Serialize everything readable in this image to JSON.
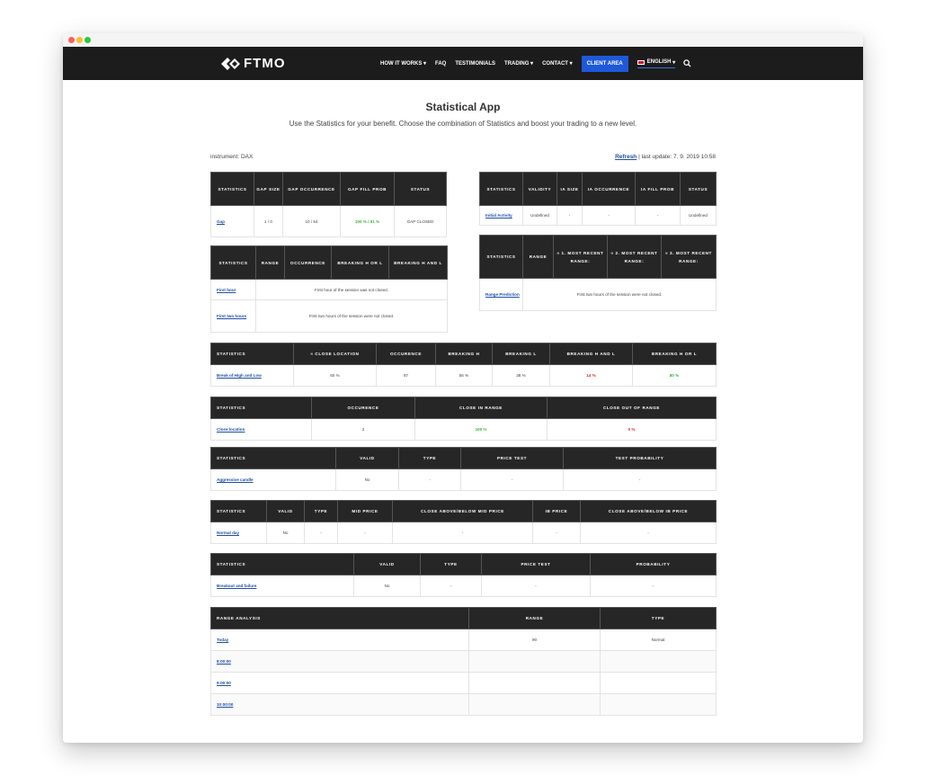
{
  "nav": {
    "logo": "FTMO",
    "items": [
      "HOW IT WORKS",
      "FAQ",
      "TESTIMONIALS",
      "TRADING",
      "CONTACT"
    ],
    "client_area": "CLIENT AREA",
    "language": "ENGLISH",
    "colors": {
      "bar": "#1c1c1c",
      "client_button": "#1e59d9"
    }
  },
  "page": {
    "title": "Statistical App",
    "subtitle": "Use the Statistics for your benefit. Choose the combination of Statistics and boost your trading to a new level.",
    "instrument": "instrument: DAX",
    "refresh": "Refresh",
    "last_update": " | last update: 7. 9. 2019 10:58"
  },
  "gap": {
    "headers": [
      "STATISTICS",
      "GAP SIZE",
      "GAP OCCURRENCE",
      "GAP FILL PROB",
      "STATUS"
    ],
    "row": {
      "stat": "Gap",
      "size": "1 / 0",
      "occurrence": "10 / 54",
      "fill_prob": "100 % / 91 %",
      "status": "GAP CLOSED"
    }
  },
  "ia": {
    "headers": [
      "STATISTICS",
      "VALIDITY",
      "IA SIZE",
      "IA OCCURRENCE",
      "IA FILL PROB",
      "STATUS"
    ],
    "row": {
      "stat": "Initial Activity",
      "validity": "Undefined",
      "size": "-",
      "occurrence": "-",
      "fill": "-",
      "status": "Undefined"
    }
  },
  "breaking": {
    "headers": [
      "STATISTICS",
      "RANGE",
      "OCCURRENCE",
      "BREAKING H OR L",
      "BREAKING H AND L"
    ],
    "rows": [
      {
        "stat": "First hour",
        "message": "First hour of the session was not closed."
      },
      {
        "stat": "First two hours",
        "message": "First two hours of the session were not closed."
      }
    ]
  },
  "range_pred": {
    "headers": [
      "STATISTICS",
      "RANGE",
      "≈ 1. MOST RECENT RANGE:",
      "≈ 2. MOST RECENT RANGE:",
      "≈ 3. MOST RECENT RANGE:"
    ],
    "row": {
      "stat": "Range Prediction",
      "message": "First two hours of the session were not closed."
    }
  },
  "bhl": {
    "headers": [
      "STATISTICS",
      "≈ CLOSE LOCATION",
      "OCCURENCE",
      "BREAKING H",
      "BREAKING L",
      "BREAKING H AND L",
      "BREAKING H OR L"
    ],
    "row": {
      "stat": "Break of High and Low",
      "close_location": "60 %",
      "occurence": "87",
      "breaking_h": "56 %",
      "breaking_l": "38 %",
      "h_and_l": "14 %",
      "h_or_l": "80 %"
    }
  },
  "close_loc": {
    "headers": [
      "STATISTICS",
      "OCCURENCE",
      "CLOSE IN RANGE",
      "CLOSE OUT OF RANGE"
    ],
    "row": {
      "stat": "Close location",
      "occurence": "2",
      "in_range": "100 %",
      "out_range": "0 %"
    }
  },
  "aggressive": {
    "headers": [
      "STATISTICS",
      "VALID",
      "TYPE",
      "PRICE TEST",
      "TEST PROBABILITY"
    ],
    "row": {
      "stat": "Aggressive candle",
      "valid": "No",
      "type": "-",
      "price_test": "-",
      "test_prob": "-"
    }
  },
  "normal": {
    "headers": [
      "STATISTICS",
      "VALID",
      "TYPE",
      "MID PRICE",
      "CLOSE ABOVE/BELOW MID PRICE",
      "IB PRICE",
      "CLOSE ABOVE/BELOW IB PRICE"
    ],
    "row": {
      "stat": "Normal day",
      "valid": "No",
      "type": "-",
      "mid": "-",
      "close_mid": "-",
      "ib": "-",
      "close_ib": "-"
    }
  },
  "breakout": {
    "headers": [
      "STATISTICS",
      "VALID",
      "TYPE",
      "PRICE TEST",
      "PROBABILITY"
    ],
    "row": {
      "stat": "Breakout and failure",
      "valid": "No",
      "type": "-",
      "price_test": "-",
      "prob": "-"
    }
  },
  "range_analysis": {
    "headers": [
      "RANGE ANALYSIS",
      "RANGE",
      "TYPE"
    ],
    "rows": [
      {
        "label": "Today",
        "range": "90",
        "type": "Normal"
      },
      {
        "label": "8:00:00",
        "range": "",
        "type": ""
      },
      {
        "label": "9:00:00",
        "range": "",
        "type": ""
      },
      {
        "label": "10:00:00",
        "range": "",
        "type": ""
      }
    ]
  }
}
